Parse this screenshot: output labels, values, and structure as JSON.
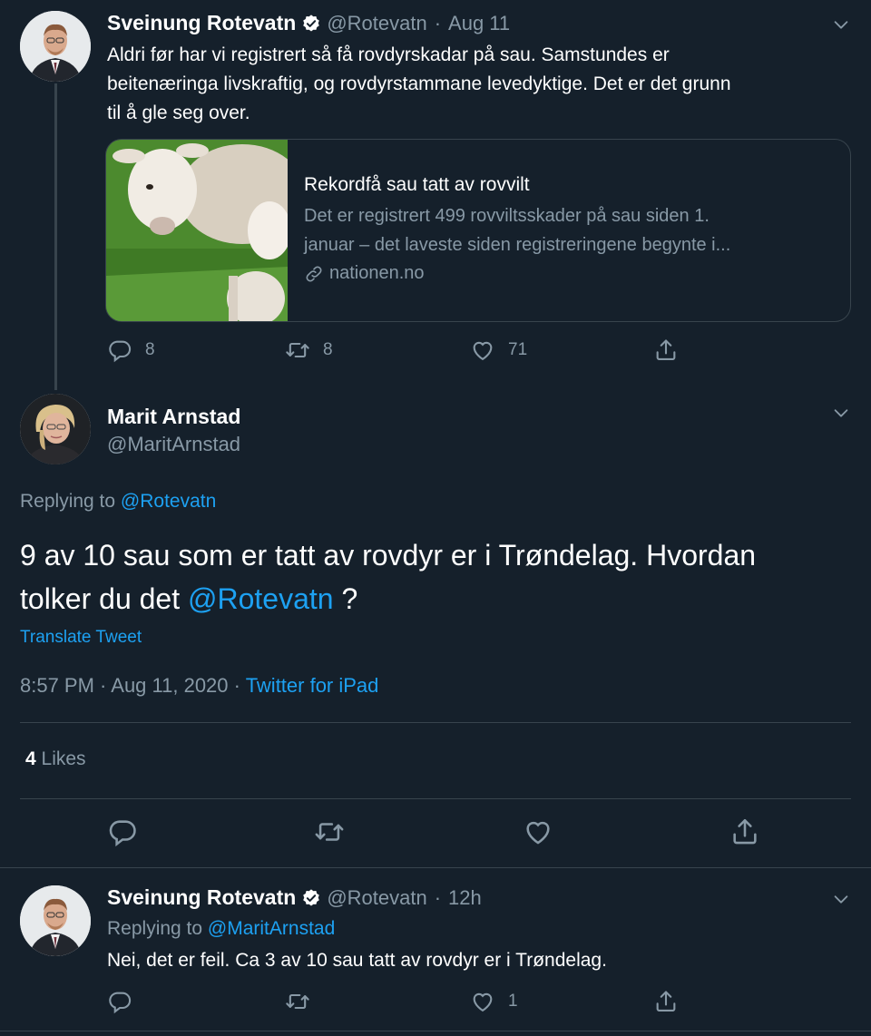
{
  "tweet1": {
    "name": "Sveinung Rotevatn",
    "handle": "@Rotevatn",
    "separator": "·",
    "time": "Aug 11",
    "text_lines": [
      "Aldri før har vi registrert så få rovdyrskadar på sau. Samstundes er",
      "beitenæringa livskraftig, og rovdyrstammane levedyktige. Det er det grunn",
      "til å gle seg over."
    ],
    "card": {
      "title": "Rekordfå sau tatt av rovvilt",
      "desc_lines": [
        "Det er registrert 499 rovviltsskader på sau siden 1.",
        "januar – det laveste siden registreringene begynte i..."
      ],
      "domain": "nationen.no"
    },
    "replies": "8",
    "retweets": "8",
    "likes": "71"
  },
  "main": {
    "name": "Marit Arnstad",
    "handle": "@MaritArnstad",
    "replying_prefix": "Replying to",
    "replying_to": "@Rotevatn",
    "text_line1": "9 av 10 sau som er tatt av rovdyr er i Trøndelag. Hvordan",
    "text_line2_prefix": "tolker du det",
    "text_mention": "@Rotevatn",
    "text_line2_suffix": "?",
    "translate": "Translate Tweet",
    "timestamp": "8:57 PM · Aug 11, 2020 ·",
    "source": "Twitter for iPad",
    "likes_count": "4",
    "likes_label": "Likes"
  },
  "tweet3": {
    "name": "Sveinung Rotevatn",
    "handle": "@Rotevatn",
    "separator": "·",
    "time": "12h",
    "replying_prefix": "Replying to",
    "replying_to": "@MaritArnstad",
    "text": "Nei, det er feil. Ca 3 av 10 sau tatt av rovdyr er i Trøndelag.",
    "likes": "1"
  },
  "colors": {
    "background": "#15202b",
    "text_muted": "#8899a6",
    "link": "#1da1f2",
    "divider": "#38444d"
  },
  "icons": [
    "reply-icon",
    "retweet-icon",
    "like-icon",
    "share-icon",
    "verified-badge-icon",
    "chevron-down-icon",
    "link-icon"
  ]
}
